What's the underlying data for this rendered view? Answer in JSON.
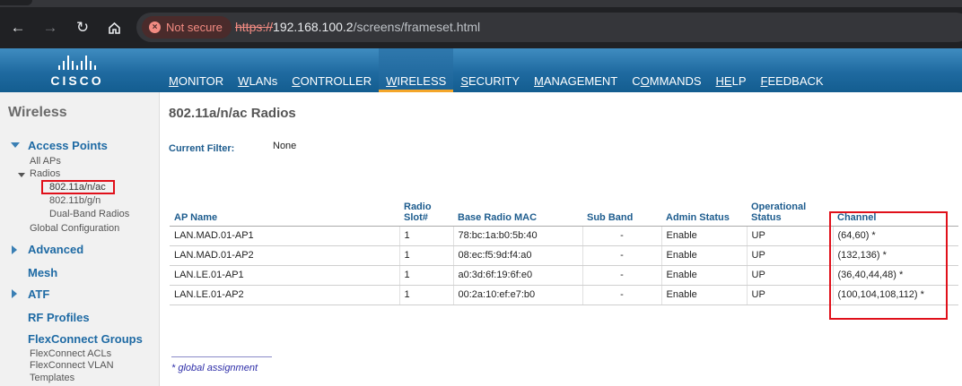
{
  "browser": {
    "security_label": "Not secure",
    "url_scheme": "https://",
    "url_host": "192.168.100.2",
    "url_path": "/screens/frameset.html"
  },
  "header": {
    "brand": "CISCO",
    "menu": [
      {
        "pre": "",
        "u": "M",
        "post": "ONITOR"
      },
      {
        "pre": "",
        "u": "W",
        "post": "LANs"
      },
      {
        "pre": "",
        "u": "C",
        "post": "ONTROLLER"
      },
      {
        "pre": "",
        "u": "W",
        "post": "IRELESS"
      },
      {
        "pre": "",
        "u": "S",
        "post": "ECURITY"
      },
      {
        "pre": "",
        "u": "M",
        "post": "ANAGEMENT"
      },
      {
        "pre": "C",
        "u": "O",
        "post": "MMANDS"
      },
      {
        "pre": "",
        "u": "HE",
        "post": "LP"
      },
      {
        "pre": "",
        "u": "F",
        "post": "EEDBACK"
      }
    ],
    "active_index": 3
  },
  "sidebar": {
    "title": "Wireless",
    "access_points": "Access Points",
    "all_aps": "All APs",
    "radios": "Radios",
    "radio_a": "802.11a/n/ac",
    "radio_b": "802.11b/g/n",
    "dual_band": "Dual-Band Radios",
    "global_config": "Global Configuration",
    "advanced": "Advanced",
    "mesh": "Mesh",
    "atf": "ATF",
    "rf_profiles": "RF Profiles",
    "flexconnect_groups": "FlexConnect Groups",
    "flexconnect_acls": "FlexConnect ACLs",
    "flexconnect_vlan": "FlexConnect VLAN",
    "templates": "Templates"
  },
  "main": {
    "title": "802.11a/n/ac Radios",
    "filter_label": "Current Filter:",
    "filter_value": "None",
    "columns": {
      "ap_name": "AP Name",
      "radio_slot_1": "Radio",
      "radio_slot_2": "Slot#",
      "base_mac": "Base Radio MAC",
      "sub_band": "Sub Band",
      "admin_status": "Admin Status",
      "op_status_1": "Operational",
      "op_status_2": "Status",
      "channel": "Channel"
    },
    "rows": [
      {
        "ap_name": "LAN.MAD.01-AP1",
        "slot": "1",
        "mac": "78:bc:1a:b0:5b:40",
        "sub_band": "-",
        "admin": "Enable",
        "oper": "UP",
        "channel": "(64,60) *"
      },
      {
        "ap_name": "LAN.MAD.01-AP2",
        "slot": "1",
        "mac": "08:ec:f5:9d:f4:a0",
        "sub_band": "-",
        "admin": "Enable",
        "oper": "UP",
        "channel": "(132,136) *"
      },
      {
        "ap_name": "LAN.LE.01-AP1",
        "slot": "1",
        "mac": "a0:3d:6f:19:6f:e0",
        "sub_band": "-",
        "admin": "Enable",
        "oper": "UP",
        "channel": "(36,40,44,48) *"
      },
      {
        "ap_name": "LAN.LE.01-AP2",
        "slot": "1",
        "mac": "00:2a:10:ef:e7:b0",
        "sub_band": "-",
        "admin": "Enable",
        "oper": "UP",
        "channel": "(100,104,108,112) *"
      }
    ],
    "footnote": "* global assignment"
  },
  "colors": {
    "highlight": "#e0101a",
    "header_blue": "#1f6aa0",
    "active_tab_underline": "#f4a62a",
    "link_blue": "#1e6aa4"
  }
}
